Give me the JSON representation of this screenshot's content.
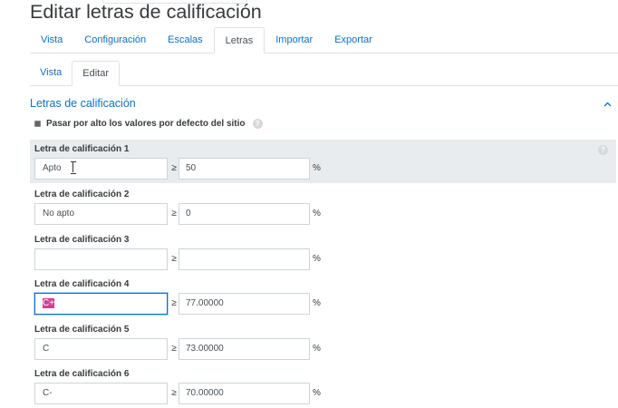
{
  "page_title": "Editar letras de calificación",
  "tabs": [
    {
      "label": "Vista",
      "active": false
    },
    {
      "label": "Configuración",
      "active": false
    },
    {
      "label": "Escalas",
      "active": false
    },
    {
      "label": "Letras",
      "active": true
    },
    {
      "label": "Importar",
      "active": false
    },
    {
      "label": "Exportar",
      "active": false
    }
  ],
  "subtabs": [
    {
      "label": "Vista",
      "active": false
    },
    {
      "label": "Editar",
      "active": true
    }
  ],
  "section": {
    "title": "Letras de calificación",
    "override_label": "Pasar por alto los valores por defecto del sitio",
    "override_checked": true
  },
  "grade_letters": [
    {
      "label": "Letra de calificación 1",
      "letter": "Apto",
      "ge": "≥",
      "value": "50",
      "unit": "%"
    },
    {
      "label": "Letra de calificación 2",
      "letter": "No apto",
      "ge": "≥",
      "value": "0",
      "unit": "%"
    },
    {
      "label": "Letra de calificación 3",
      "letter": "",
      "ge": "≥",
      "value": "",
      "unit": "%"
    },
    {
      "label": "Letra de calificación 4",
      "letter": "C+",
      "ge": "≥",
      "value": "77.00000",
      "unit": "%"
    },
    {
      "label": "Letra de calificación 5",
      "letter": "C",
      "ge": "≥",
      "value": "73.00000",
      "unit": "%"
    },
    {
      "label": "Letra de calificación 6",
      "letter": "C-",
      "ge": "≥",
      "value": "70.00000",
      "unit": "%"
    }
  ],
  "icons": {
    "help": "?",
    "collapse": "chevron-up-icon",
    "check": "✔"
  },
  "colors": {
    "link": "#0f6fc5",
    "highlight_row": "#e9ecef",
    "selection": "#d43d93"
  }
}
